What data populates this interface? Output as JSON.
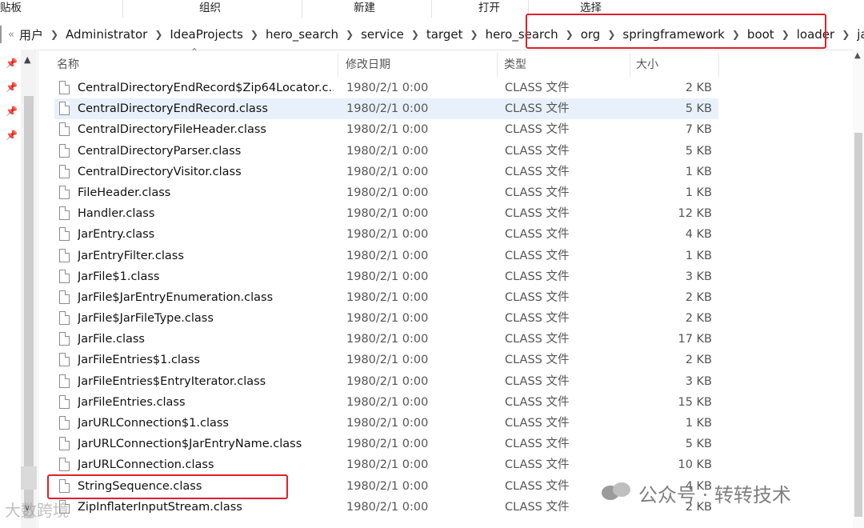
{
  "ribbon": {
    "groups": [
      "贴板",
      "组织",
      "新建",
      "打开",
      "选择"
    ]
  },
  "address": {
    "more": "«",
    "crumbs": [
      "用户",
      "Administrator",
      "IdeaProjects",
      "hero_search",
      "service",
      "target",
      "hero_search",
      "org",
      "springframework",
      "boot",
      "loader",
      "jar"
    ]
  },
  "columns": {
    "name": "名称",
    "date": "修改日期",
    "type": "类型",
    "size": "大小"
  },
  "files": [
    {
      "name": "CentralDirectoryEndRecord$Zip64Locator.c...",
      "date": "1980/2/1 0:00",
      "type": "CLASS 文件",
      "size": "2 KB"
    },
    {
      "name": "CentralDirectoryEndRecord.class",
      "date": "1980/2/1 0:00",
      "type": "CLASS 文件",
      "size": "5 KB"
    },
    {
      "name": "CentralDirectoryFileHeader.class",
      "date": "1980/2/1 0:00",
      "type": "CLASS 文件",
      "size": "7 KB"
    },
    {
      "name": "CentralDirectoryParser.class",
      "date": "1980/2/1 0:00",
      "type": "CLASS 文件",
      "size": "5 KB"
    },
    {
      "name": "CentralDirectoryVisitor.class",
      "date": "1980/2/1 0:00",
      "type": "CLASS 文件",
      "size": "1 KB"
    },
    {
      "name": "FileHeader.class",
      "date": "1980/2/1 0:00",
      "type": "CLASS 文件",
      "size": "1 KB"
    },
    {
      "name": "Handler.class",
      "date": "1980/2/1 0:00",
      "type": "CLASS 文件",
      "size": "12 KB"
    },
    {
      "name": "JarEntry.class",
      "date": "1980/2/1 0:00",
      "type": "CLASS 文件",
      "size": "4 KB"
    },
    {
      "name": "JarEntryFilter.class",
      "date": "1980/2/1 0:00",
      "type": "CLASS 文件",
      "size": "1 KB"
    },
    {
      "name": "JarFile$1.class",
      "date": "1980/2/1 0:00",
      "type": "CLASS 文件",
      "size": "3 KB"
    },
    {
      "name": "JarFile$JarEntryEnumeration.class",
      "date": "1980/2/1 0:00",
      "type": "CLASS 文件",
      "size": "2 KB"
    },
    {
      "name": "JarFile$JarFileType.class",
      "date": "1980/2/1 0:00",
      "type": "CLASS 文件",
      "size": "2 KB"
    },
    {
      "name": "JarFile.class",
      "date": "1980/2/1 0:00",
      "type": "CLASS 文件",
      "size": "17 KB"
    },
    {
      "name": "JarFileEntries$1.class",
      "date": "1980/2/1 0:00",
      "type": "CLASS 文件",
      "size": "2 KB"
    },
    {
      "name": "JarFileEntries$EntryIterator.class",
      "date": "1980/2/1 0:00",
      "type": "CLASS 文件",
      "size": "3 KB"
    },
    {
      "name": "JarFileEntries.class",
      "date": "1980/2/1 0:00",
      "type": "CLASS 文件",
      "size": "15 KB"
    },
    {
      "name": "JarURLConnection$1.class",
      "date": "1980/2/1 0:00",
      "type": "CLASS 文件",
      "size": "1 KB"
    },
    {
      "name": "JarURLConnection$JarEntryName.class",
      "date": "1980/2/1 0:00",
      "type": "CLASS 文件",
      "size": "5 KB"
    },
    {
      "name": "JarURLConnection.class",
      "date": "1980/2/1 0:00",
      "type": "CLASS 文件",
      "size": "10 KB"
    },
    {
      "name": "StringSequence.class",
      "date": "1980/2/1 0:00",
      "type": "CLASS 文件",
      "size": "4 KB"
    },
    {
      "name": "ZipInflaterInputStream.class",
      "date": "1980/2/1 0:00",
      "type": "CLASS 文件",
      "size": "2 KB"
    }
  ],
  "selected_index": 1,
  "watermark": {
    "text": "公众号 · 转转技术",
    "corner_text": "大数跨境"
  },
  "colors": {
    "highlight_box": "#e0202a",
    "selection": "#e8f1fb"
  }
}
